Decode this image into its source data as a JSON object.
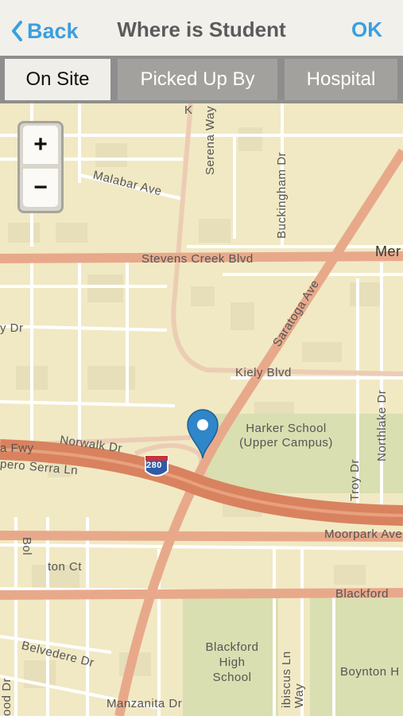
{
  "nav": {
    "back": "Back",
    "title": "Where is Student",
    "ok": "OK"
  },
  "tabs": [
    {
      "label": "On Site",
      "active": true
    },
    {
      "label": "Picked Up By",
      "active": false
    },
    {
      "label": "Hospital",
      "active": false
    }
  ],
  "zoom": {
    "in": "+",
    "out": "−"
  },
  "map_labels": {
    "malabar": "Malabar Ave",
    "serena": "Serena Way",
    "buckingham": "Buckingham Dr",
    "stevens": "Stevens Creek Blvd",
    "mer": "Mer",
    "saratoga": "Saratoga Ave",
    "dr_left": "y Dr",
    "kiely": "Kiely Blvd",
    "norwalk": "Norwalk Dr",
    "fwy": "a Fwy",
    "junipero": "pero Serra Ln",
    "shield": "280",
    "harker": "Harker School (Upper Campus)",
    "troy": "Troy Dr",
    "northlake": "Northlake Dr",
    "moorpark": "Moorpark Ave",
    "bol": "Bol",
    "ton": "ton Ct",
    "blackford_rd": "Blackford",
    "belvedere": "Belvedere Dr",
    "blackford_school": "Blackford High School",
    "hibiscus": "ibiscus Ln",
    "way": "Way",
    "boynton": "Boynton H",
    "wood": "ood Dr",
    "manzanita": "Manzanita Dr",
    "k_top": "K"
  },
  "colors": {
    "accent": "#3a9fe0",
    "major_road": "#e8a98b",
    "freeway": "#d9825f",
    "map_bg": "#f1e9c4",
    "pin": "#2f86c9"
  },
  "icons": {
    "back": "chevron-left-icon",
    "marker": "map-pin-icon"
  }
}
